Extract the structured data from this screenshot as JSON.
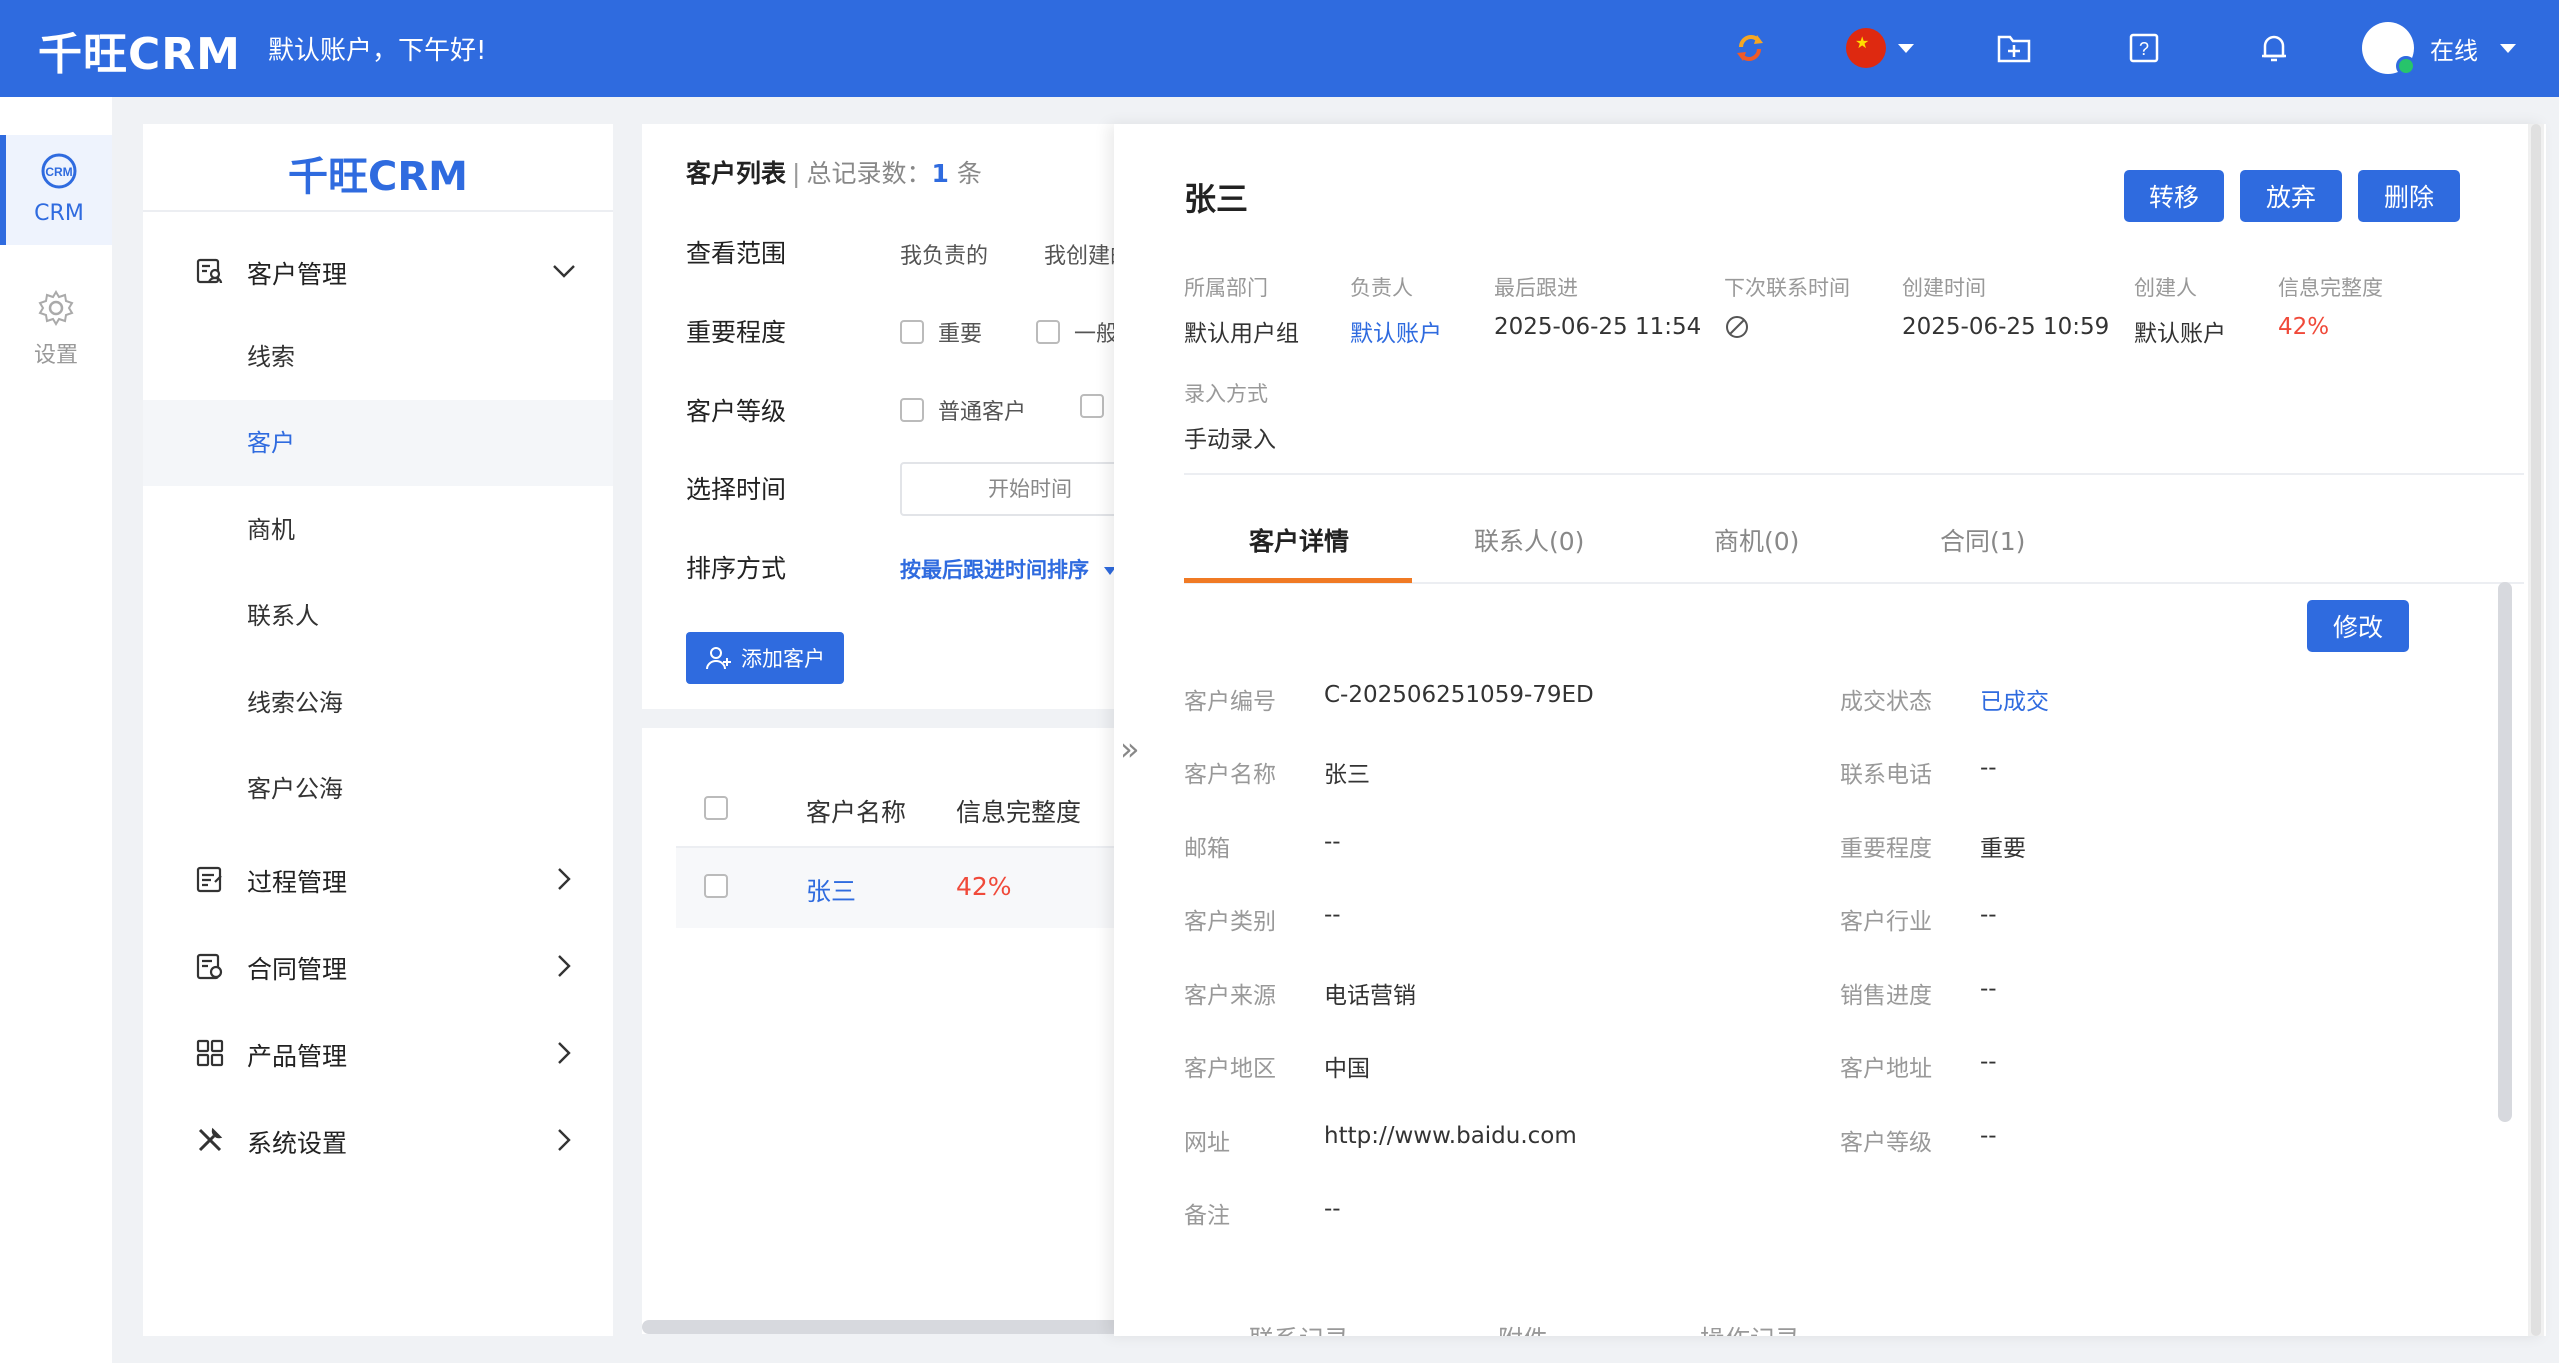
{
  "header": {
    "logo": "千旺CRM",
    "greeting": "默认账户，下午好!",
    "user_status": "在线"
  },
  "rail": {
    "items": [
      {
        "label": "CRM",
        "icon": "crm-icon"
      },
      {
        "label": "设置",
        "icon": "gear-icon"
      }
    ]
  },
  "sidebar": {
    "brand": "千旺CRM",
    "groups": [
      {
        "label": "客户管理",
        "icon": "customer-manage-icon"
      },
      {
        "label": "过程管理",
        "icon": "process-manage-icon"
      },
      {
        "label": "合同管理",
        "icon": "contract-manage-icon"
      },
      {
        "label": "产品管理",
        "icon": "product-manage-icon"
      },
      {
        "label": "系统设置",
        "icon": "tools-icon"
      }
    ],
    "sub_items": [
      "线索",
      "客户",
      "商机",
      "联系人",
      "线索公海",
      "客户公海"
    ]
  },
  "list": {
    "title": "客户列表",
    "separator": "|",
    "count_label": "总记录数：",
    "count": "1",
    "count_unit": "条",
    "filters": {
      "scope_label": "查看范围",
      "scope_opt1": "我负责的",
      "scope_opt2": "我创建的",
      "importance_label": "重要程度",
      "importance_opt1": "重要",
      "importance_opt2": "一般",
      "level_label": "客户等级",
      "level_opt1": "普通客户",
      "time_label": "选择时间",
      "time_placeholder": "开始时间",
      "sort_label": "排序方式",
      "sort_value": "按最后跟进时间排序"
    },
    "add_button": "添加客户",
    "columns": [
      "客户名称",
      "信息完整度"
    ],
    "rows": [
      {
        "name": "张三",
        "completeness": "42%"
      }
    ]
  },
  "detail": {
    "name": "张三",
    "buttons": {
      "transfer": "转移",
      "abandon": "放弃",
      "delete": "删除",
      "edit": "修改"
    },
    "meta": [
      {
        "label": "所属部门",
        "value": "默认用户组"
      },
      {
        "label": "负责人",
        "value": "默认账户"
      },
      {
        "label": "最后跟进",
        "value": "2025-06-25 11:54"
      },
      {
        "label": "下次联系时间",
        "value": ""
      },
      {
        "label": "创建时间",
        "value": "2025-06-25 10:59"
      },
      {
        "label": "创建人",
        "value": "默认账户"
      },
      {
        "label": "信息完整度",
        "value": "42%"
      }
    ],
    "entry_method_label": "录入方式",
    "entry_method_value": "手动录入",
    "tabs": [
      "客户详情",
      "联系人(0)",
      "商机(0)",
      "合同(1)"
    ],
    "fields_left": [
      {
        "label": "客户编号",
        "value": "C-202506251059-79ED"
      },
      {
        "label": "客户名称",
        "value": "张三"
      },
      {
        "label": "邮箱",
        "value": "--"
      },
      {
        "label": "客户类别",
        "value": "--"
      },
      {
        "label": "客户来源",
        "value": "电话营销"
      },
      {
        "label": "客户地区",
        "value": "中国"
      },
      {
        "label": "网址",
        "value": "http://www.baidu.com"
      },
      {
        "label": "备注",
        "value": "--"
      }
    ],
    "fields_right": [
      {
        "label": "成交状态",
        "value": "已成交"
      },
      {
        "label": "联系电话",
        "value": "--"
      },
      {
        "label": "重要程度",
        "value": "重要"
      },
      {
        "label": "客户行业",
        "value": "--"
      },
      {
        "label": "销售进度",
        "value": "--"
      },
      {
        "label": "客户地址",
        "value": "--"
      },
      {
        "label": "客户等级",
        "value": "--"
      }
    ],
    "bottom_tabs": [
      "联系记录",
      "附件",
      "操作记录"
    ]
  },
  "colors": {
    "primary": "#2f6bdf",
    "accent_orange": "#f07a24",
    "danger_red": "#f04a3a"
  }
}
